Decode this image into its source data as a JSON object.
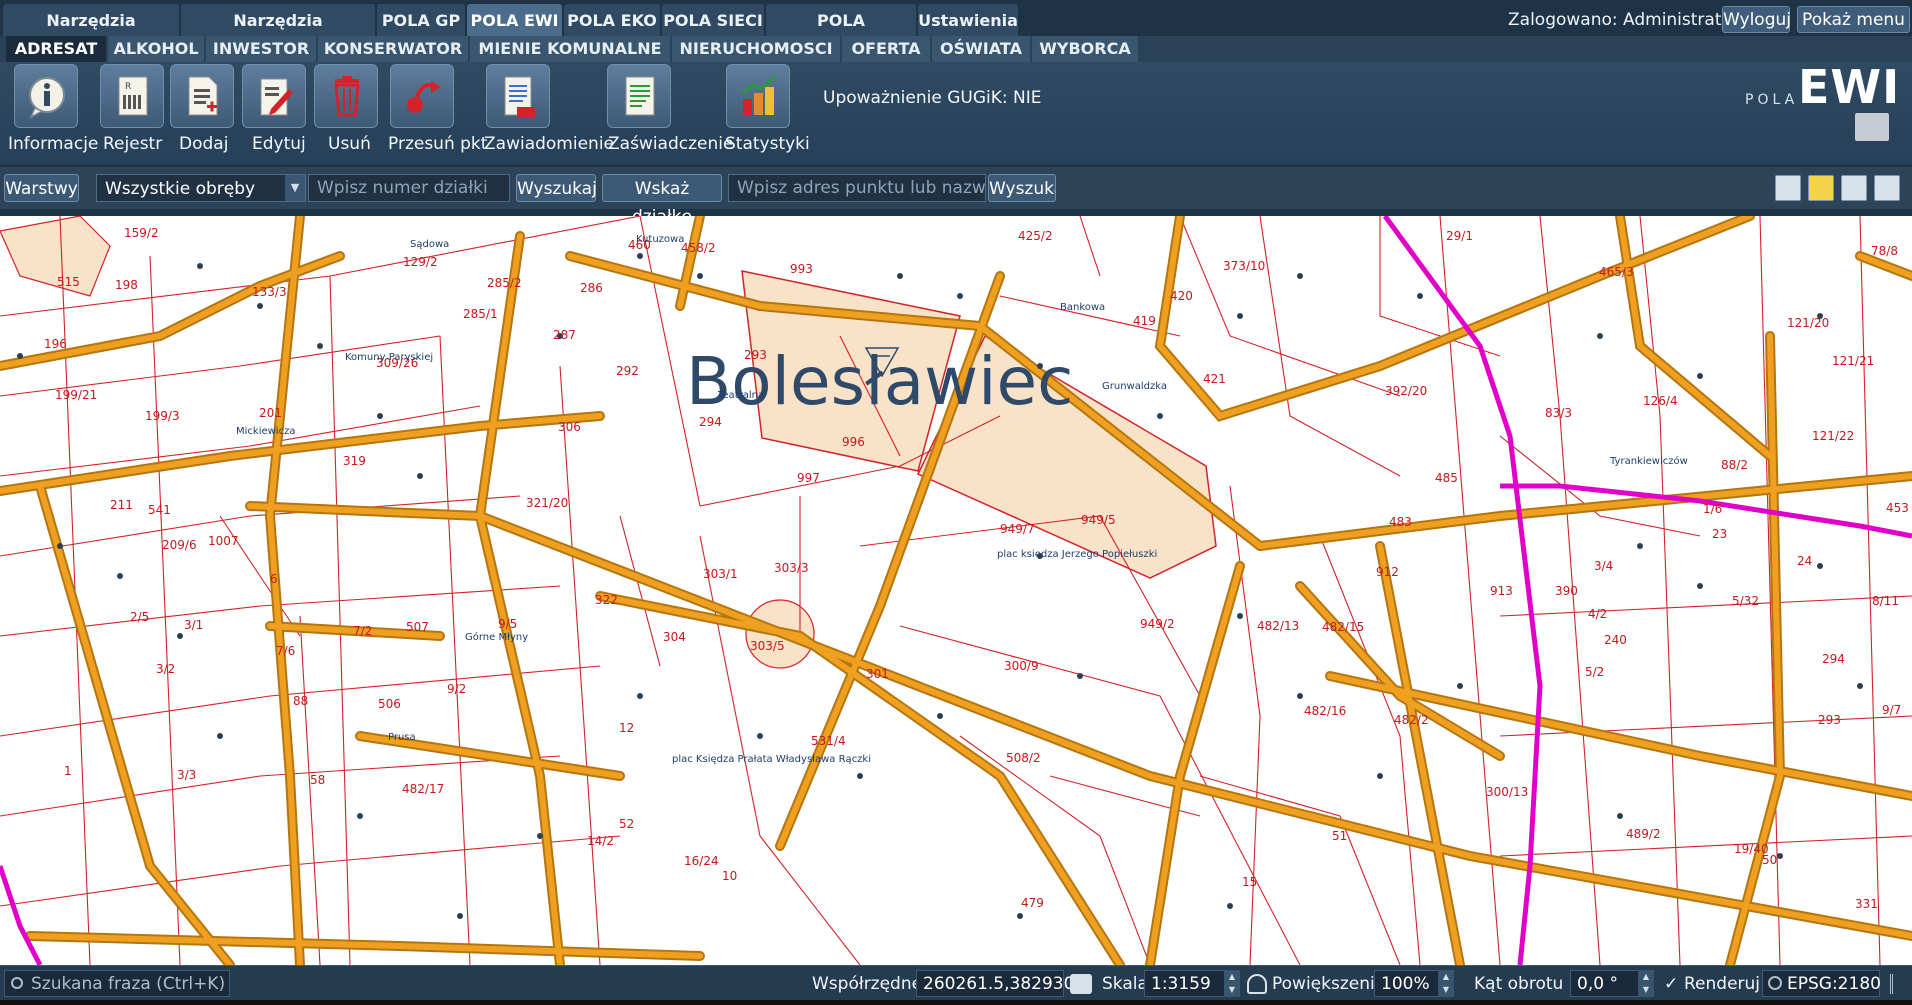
{
  "top_tabs": [
    {
      "label": "Narzędzia podstawowe"
    },
    {
      "label": "Narzędzia zaawansowane"
    },
    {
      "label": "POLA GP"
    },
    {
      "label": "POLA EWI"
    },
    {
      "label": "POLA EKO"
    },
    {
      "label": "POLA SIECI"
    },
    {
      "label": "POLA INTEGRACJE"
    },
    {
      "label": "Ustawienia"
    }
  ],
  "active_top_tab": "POLA EWI",
  "header": {
    "login_text": "Zalogowano: Administrator",
    "logout_label": "Wyloguj",
    "show_menu_label": "Pokaż menu"
  },
  "sub_tabs": [
    {
      "label": "ADRESAT"
    },
    {
      "label": "ALKOHOL"
    },
    {
      "label": "INWESTOR"
    },
    {
      "label": "KONSERWATOR"
    },
    {
      "label": "MIENIE KOMUNALNE"
    },
    {
      "label": "NIERUCHOMOSCI"
    },
    {
      "label": "OFERTA"
    },
    {
      "label": "OŚWIATA"
    },
    {
      "label": "WYBORCA"
    }
  ],
  "active_sub_tab": "ADRESAT",
  "toolbar": {
    "tools": [
      {
        "label": "Informacje",
        "icon": "info-icon"
      },
      {
        "label": "Rejestr",
        "icon": "register-icon"
      },
      {
        "label": "Dodaj",
        "icon": "add-document-icon"
      },
      {
        "label": "Edytuj",
        "icon": "edit-icon"
      },
      {
        "label": "Usuń",
        "icon": "trash-icon"
      },
      {
        "label": "Przesuń pkt",
        "icon": "move-point-icon"
      },
      {
        "label": "Zawiadomienie",
        "icon": "notice-document-icon"
      },
      {
        "label": "Zaświadczenie",
        "icon": "certificate-document-icon"
      },
      {
        "label": "Statystyki",
        "icon": "statistics-icon"
      }
    ],
    "gugik_text": "Upoważnienie GUGiK: NIE"
  },
  "logo": {
    "pola": "POLA",
    "ewi": "EWI"
  },
  "search": {
    "layers_label": "Warstwy",
    "obreby_value": "Wszystkie obręby",
    "parcel_placeholder": "Wpisz numer działki",
    "search_label": "Wyszukaj",
    "show_parcel_label": "Wskaż działkę",
    "address_placeholder": "Wpisz adres punktu lub nazw...",
    "address_search_label": "Wyszuka"
  },
  "map": {
    "city_name": "Bolesławiec",
    "plac_1": "plac księdza Jerzego Popiełuszki",
    "plac_2": "plac Księdza Prałata Władysława Rączki",
    "parcels": [
      "159/2",
      "515",
      "198",
      "129/2",
      "460",
      "458/2",
      "993",
      "425/2",
      "29/1",
      "465/3",
      "78/8",
      "133/3",
      "285/2",
      "286",
      "373/10",
      "420",
      "419",
      "121/20",
      "196",
      "285/1",
      "287",
      "293",
      "421",
      "392/20",
      "309/26",
      "292",
      "121/21",
      "199/21",
      "201",
      "294",
      "126/4",
      "83/3",
      "199/3",
      "306",
      "996",
      "121/22",
      "319",
      "997",
      "485",
      "88/2",
      "453",
      "211",
      "541",
      "321/20",
      "949/7",
      "949/5",
      "483",
      "1/6",
      "23",
      "209/6",
      "1007",
      "3/4",
      "24",
      "303/1",
      "303/3",
      "912",
      "913",
      "390",
      "6",
      "322",
      "8/11",
      "2/5",
      "3/1",
      "7/2",
      "507",
      "9/5",
      "4/2",
      "5/32",
      "7/6",
      "304",
      "303/5",
      "949/2",
      "482/13",
      "482/15",
      "240",
      "294",
      "3/2",
      "301",
      "300/9",
      "5/2",
      "88",
      "506",
      "9/2",
      "482/16",
      "482/2",
      "293",
      "9/7",
      "12",
      "531/4",
      "1",
      "3/3",
      "58",
      "508/2",
      "300/13",
      "482/17",
      "52",
      "51",
      "489/2",
      "14/2",
      "50",
      "16/24",
      "10",
      "19/40",
      "15",
      "479",
      "331",
      "17"
    ],
    "streets": [
      "Sądowa",
      "Kutuzowa",
      "Mickiewicza",
      "Komuny Paryskiej",
      "Teatralna",
      "Bankowa",
      "Grunwaldzka",
      "Tyrankiewiczów",
      "Górne Młyny",
      "Prusa"
    ]
  },
  "status": {
    "phrase_placeholder": "Szukana fraza (Ctrl+K)",
    "coords_label": "Współrzędne",
    "coords_value": "260261.5,382930.3",
    "scale_label": "Skala",
    "scale_value": "1:3159",
    "zoom_label": "Powiększenie",
    "zoom_value": "100%",
    "rotation_label": "Kąt obrotu",
    "rotation_value": "0,0 °",
    "render_label": "Renderuj",
    "render_checked": true,
    "epsg_label": "EPSG:2180"
  },
  "colors": {
    "ui_dark": "#1f3346",
    "active_tab": "#4b6c8a",
    "parcel_line": "#d3222a",
    "road": "#f0a020",
    "road_border": "#b57610",
    "highlight_parcel": "#f8e2c8",
    "magenta_line": "#e000c8",
    "city_name": "#2e4a68"
  }
}
